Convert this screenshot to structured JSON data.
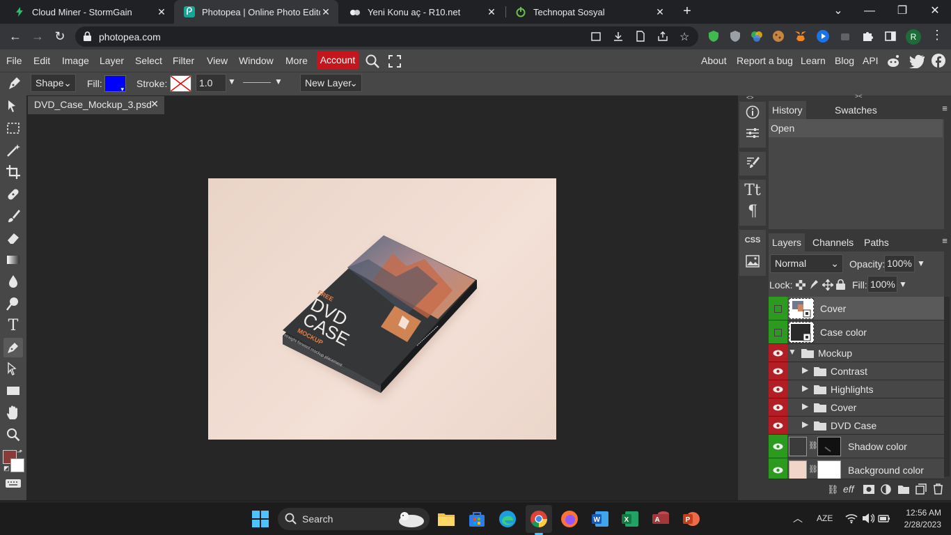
{
  "browser": {
    "tabs": [
      {
        "title": "Cloud Miner - StormGain",
        "icon": "lightning-icon",
        "active": false
      },
      {
        "title": "Photopea | Online Photo Editor",
        "icon": "photopea-icon",
        "active": true
      },
      {
        "title": "Yeni Konu aç - R10.net",
        "icon": "r10-icon",
        "active": false
      },
      {
        "title": "Technopat Sosyal",
        "icon": "power-icon",
        "active": false
      }
    ],
    "url": "photopea.com"
  },
  "menubar": {
    "items": [
      "File",
      "Edit",
      "Image",
      "Layer",
      "Select",
      "Filter",
      "View",
      "Window",
      "More"
    ],
    "account": "Account",
    "right_links": [
      "About",
      "Report a bug",
      "Learn",
      "Blog",
      "API"
    ]
  },
  "options": {
    "mode": "Shape",
    "fill_label": "Fill:",
    "fill_color": "#0000ff",
    "stroke_label": "Stroke:",
    "stroke_width": "1.0 px",
    "new_layer": "New Layer"
  },
  "document": {
    "tab_title": "DVD_Case_Mockup_3.psd",
    "cover_text": {
      "free": "FREE",
      "dvd": "DVD",
      "case": "CASE",
      "mockup": "MOCKUP",
      "tagline": "straight-forward mockup placement"
    }
  },
  "history_panel": {
    "tabs": [
      "History",
      "Swatches"
    ],
    "items": [
      "Open"
    ]
  },
  "layers_panel": {
    "tabs": [
      "Layers",
      "Channels",
      "Paths"
    ],
    "blend_mode": "Normal",
    "opacity_label": "Opacity:",
    "opacity": "100%",
    "lock_label": "Lock:",
    "fill_label": "Fill:",
    "fill": "100%",
    "layers": [
      {
        "name": "Cover",
        "kind": "smart",
        "visible": false,
        "selected": true
      },
      {
        "name": "Case color",
        "kind": "smart",
        "visible": false
      },
      {
        "name": "Mockup",
        "kind": "folder-open",
        "visible": true
      },
      {
        "name": "Contrast",
        "kind": "folder",
        "visible": true
      },
      {
        "name": "Highlights",
        "kind": "folder",
        "visible": true
      },
      {
        "name": "Cover",
        "kind": "folder",
        "visible": true
      },
      {
        "name": "DVD Case",
        "kind": "folder",
        "visible": true
      },
      {
        "name": "Shadow color",
        "kind": "adjust",
        "visible": true
      },
      {
        "name": "Background color",
        "kind": "adjust",
        "visible": true
      }
    ],
    "footer_eff": "eff"
  },
  "taskbar": {
    "search": "Search",
    "lang": "AZE",
    "time": "12:56 AM",
    "date": "2/28/2023"
  },
  "colors": {
    "primary": "#8b3a3a",
    "secondary": "#ffffff",
    "accent_red": "#c4161c",
    "eye_red": "#b31d24",
    "eye_green": "#2b9a1f"
  }
}
